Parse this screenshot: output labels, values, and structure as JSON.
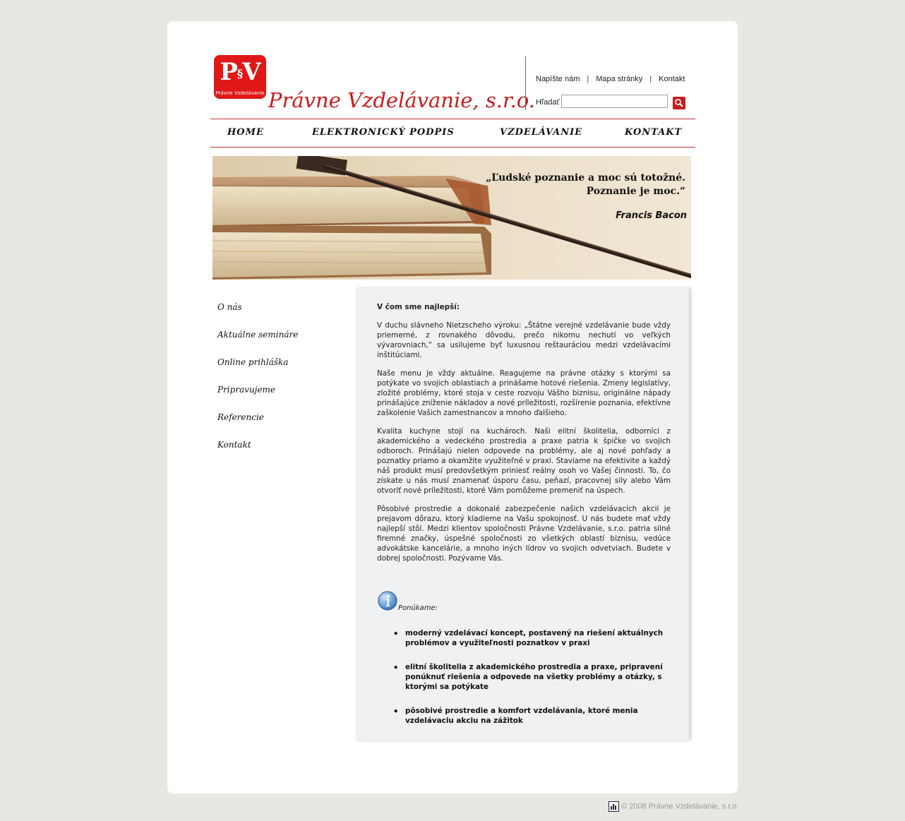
{
  "header": {
    "logo_mono": "P",
    "logo_mono_mid": "§",
    "logo_mono_end": "V",
    "logo_small": "Právne Vzdelávanie",
    "brand": "Právne Vzdelávanie, s.r.o.",
    "links": [
      "Napíšte nám",
      "Mapa stránky",
      "Kontakt"
    ],
    "link_sep": "|",
    "search_label": "Hľadať"
  },
  "nav": {
    "items": [
      "HOME",
      "ELEKTRONICKÝ PODPIS",
      "VZDELÁVANIE",
      "KONTAKT"
    ]
  },
  "banner": {
    "quote_line1": "„Ľudské poznanie a moc sú totožné.",
    "quote_line2": "Poznanie je moc.“",
    "author": "Francis Bacon"
  },
  "sidebar": {
    "items": [
      "O nás",
      "Aktuálne semináre",
      "Online prihláška",
      "Pripravujeme",
      "Referencie",
      "Kontakt"
    ]
  },
  "content": {
    "heading": "V čom sme najlepší:",
    "paragraphs": [
      "V duchu slávneho Nietzscheho výroku: „Štátne verejné vzdelávanie bude vždy priemerné, z rovnakého dôvodu, prečo nikomu nechutí vo veľkých vývarovniach,“ sa usilujeme byť luxusnou reštauráciou medzi vzdelávacími inštitúciami.",
      "Naše menu je vždy aktuálne. Reagujeme na právne otázky s ktorými sa potýkate vo svojich oblastiach a prinášame hotové riešenia. Zmeny legislatívy, zložité problémy, ktoré stoja v ceste rozvoju Vášho biznisu, originálne nápady prinášajúce zníženie nákladov a nové príležitosti, rozšírenie poznania, efektívne zaškolenie Vašich zamestnancov a mnoho ďalšieho.",
      "Kvalita kuchyne stojí na kuchároch. Naši elitní školitelia, odborníci z akademického a vedeckého prostredia a praxe patria k špičke vo svojich odboroch. Prinášajú nielen odpovede na problémy, ale aj nové pohľady a poznatky priamo a okamžite využiteľné v praxi. Staviame na efektivite a každý náš produkt musí predovšetkým priniesť reálny osoh vo Vašej činnosti. To, čo získate u nás musí znamenať úsporu času, peňazí, pracovnej sily alebo Vám otvoriť nové príležitosti, ktoré Vám pomôžeme premeniť na úspech.",
      "Pôsobivé prostredie a dokonalé zabezpečenie našich vzdelávacích akcií je prejavom dôrazu, ktorý kladieme na Vašu spokojnosť. U nás budete mať vždy najlepší stôl. Medzi klientov spoločnosti Právne Vzdelávanie, s.r.o. patria silné firemné značky, úspešné spoločnosti zo všetkých oblastí biznisu, vedúce advokátske kancelárie, a mnoho iných lídrov vo svojich odvetviach. Budete v dobrej spoločnosti. Pozývame Vás."
    ],
    "offer_label": "Ponúkame:",
    "offers": [
      "moderný vzdelávací koncept, postavený na riešení aktuálnych problémov a využiteľnosti poznatkov v praxi",
      "elitní školitelia z akademického prostredia a praxe, pripravení ponúknuť riešenia a odpovede na všetky problémy a otázky, s ktorými sa potýkate",
      "pôsobivé prostredie a komfort vzdelávania, ktoré menia vzdelávaciu akciu na zážitok"
    ]
  },
  "footer": {
    "copyright": "© 2008 Právne Vzdelávanie, s.r.o."
  },
  "colors": {
    "brand_red": "#cc1a1a",
    "background": "#e8e8e2",
    "content_bg": "#eff1f3"
  },
  "icons": [
    "search-icon",
    "info-icon",
    "stats-icon"
  ]
}
